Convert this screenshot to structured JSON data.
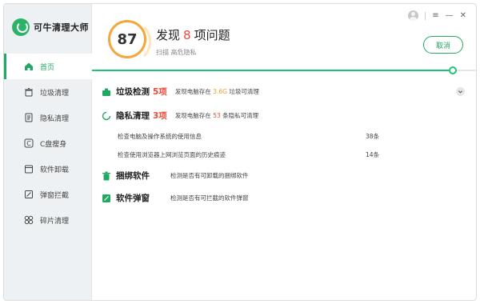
{
  "app": {
    "logo_text": "可牛清理大师"
  },
  "sidebar": {
    "items": [
      {
        "label": "首页",
        "icon": "home-icon"
      },
      {
        "label": "垃圾清理",
        "icon": "trash-clean-icon"
      },
      {
        "label": "隐私清理",
        "icon": "privacy-icon"
      },
      {
        "label": "C盘瘦身",
        "icon": "disk-c-icon"
      },
      {
        "label": "软件卸载",
        "icon": "uninstall-icon"
      },
      {
        "label": "弹窗拦截",
        "icon": "popup-block-icon"
      },
      {
        "label": "碎片清理",
        "icon": "fragment-icon"
      }
    ]
  },
  "header": {
    "score": "87",
    "title_prefix": "发现",
    "issue_count": "8",
    "title_suffix": "项问题",
    "subtitle": "扫描 高危隐私",
    "cancel_label": "取消"
  },
  "window": {
    "menu": "≡",
    "minimize": "—",
    "close": "✕"
  },
  "progress": {
    "percent": 94
  },
  "scan": {
    "junk": {
      "title": "垃圾检测",
      "count": "5项",
      "desc_pre": "发现电脑存在",
      "size": "3.6G",
      "desc_post": "垃圾可清理"
    },
    "privacy": {
      "title": "隐私清理",
      "count": "3项",
      "desc_pre": "发现电脑存在",
      "num": "53",
      "desc_post": "条隐私可清理",
      "items": [
        {
          "label": "检查电脑及操作系统的使用信息",
          "count": "38条"
        },
        {
          "label": "检查使用浏览器上网浏览页面的历史痕迹",
          "count": "14条"
        }
      ]
    },
    "bundle": {
      "title": "捆绑软件",
      "desc": "检测是否有可卸载的捆绑软件"
    },
    "popup": {
      "title": "软件弹窗",
      "desc": "检测是否有可拦截的软件弹窗"
    }
  },
  "colors": {
    "accent": "#21a862",
    "warn": "#e84a3a",
    "amber": "#f29a2e",
    "ring": "#f4a73a"
  }
}
